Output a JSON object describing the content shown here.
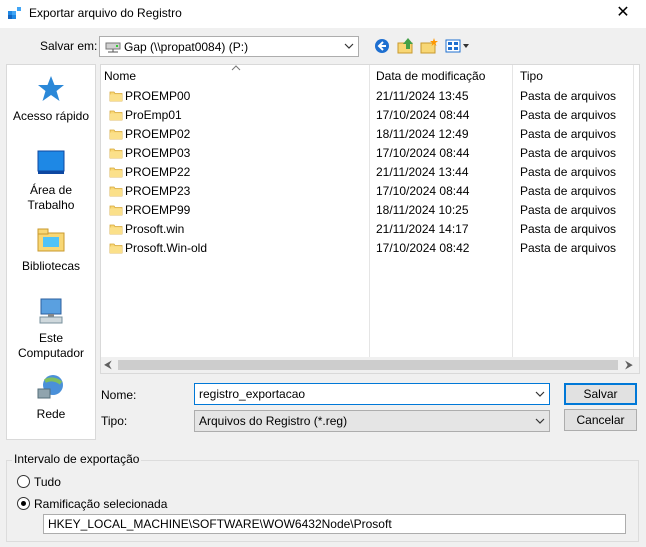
{
  "window": {
    "title": "Exportar arquivo do Registro",
    "close_glyph": "✕"
  },
  "toolbar": {
    "save_in_label": "Salvar em:",
    "location": "Gap (\\\\propat0084) (P:)",
    "icons": [
      "back-icon",
      "up-folder-icon",
      "new-folder-icon",
      "view-menu-icon"
    ]
  },
  "places": [
    {
      "label": "Acesso rápido",
      "icon": "star-icon"
    },
    {
      "label": "Área de Trabalho",
      "icon": "desktop-icon"
    },
    {
      "label": "Bibliotecas",
      "icon": "libraries-icon"
    },
    {
      "label": "Este Computador",
      "icon": "computer-icon"
    },
    {
      "label": "Rede",
      "icon": "network-icon"
    }
  ],
  "filelist": {
    "columns": {
      "name": "Nome",
      "date": "Data de modificação",
      "type": "Tipo"
    },
    "rows": [
      {
        "name": "PROEMP00",
        "date": "21/11/2024 13:45",
        "type": "Pasta de arquivos"
      },
      {
        "name": "ProEmp01",
        "date": "17/10/2024 08:44",
        "type": "Pasta de arquivos"
      },
      {
        "name": "PROEMP02",
        "date": "18/11/2024 12:49",
        "type": "Pasta de arquivos"
      },
      {
        "name": "PROEMP03",
        "date": "17/10/2024 08:44",
        "type": "Pasta de arquivos"
      },
      {
        "name": "PROEMP22",
        "date": "21/11/2024 13:44",
        "type": "Pasta de arquivos"
      },
      {
        "name": "PROEMP23",
        "date": "17/10/2024 08:44",
        "type": "Pasta de arquivos"
      },
      {
        "name": "PROEMP99",
        "date": "18/11/2024 10:25",
        "type": "Pasta de arquivos"
      },
      {
        "name": "Prosoft.win",
        "date": "21/11/2024 14:17",
        "type": "Pasta de arquivos"
      },
      {
        "name": "Prosoft.Win-old",
        "date": "17/10/2024 08:42",
        "type": "Pasta de arquivos"
      }
    ]
  },
  "form": {
    "name_label": "Nome:",
    "name_value": "registro_exportacao",
    "type_label": "Tipo:",
    "type_value": "Arquivos do Registro (*.reg)",
    "save_button": "Salvar",
    "cancel_button": "Cancelar"
  },
  "export_range": {
    "group_label": "Intervalo de exportação",
    "option_all": "Tudo",
    "option_branch": "Ramificação selecionada",
    "selected": "branch",
    "branch_path": "HKEY_LOCAL_MACHINE\\SOFTWARE\\WOW6432Node\\Prosoft"
  },
  "colors": {
    "accent": "#0078d7",
    "folder": "#f8d775",
    "folder_dark": "#e0b040"
  }
}
